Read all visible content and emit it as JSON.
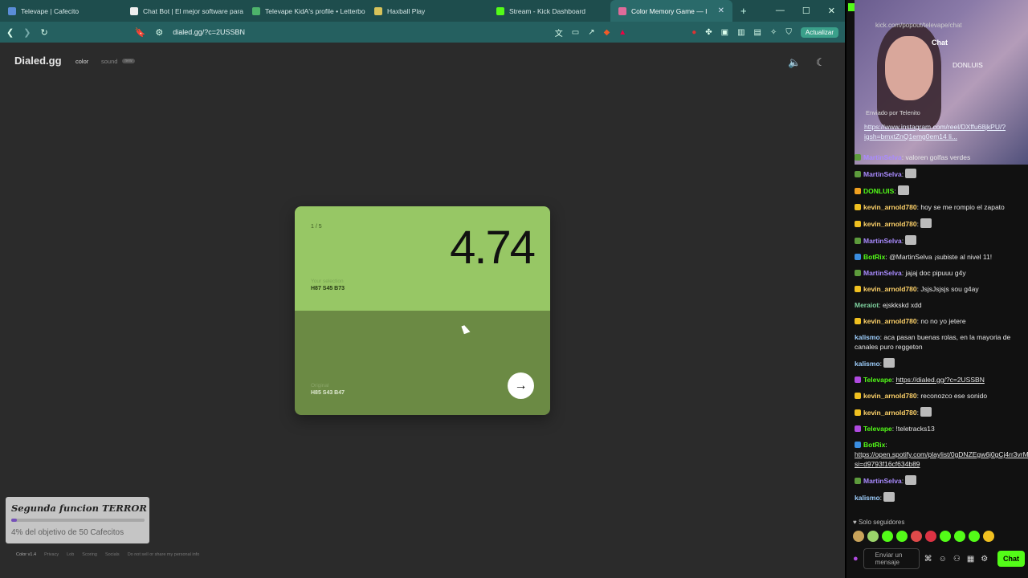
{
  "browser": {
    "tabs": [
      {
        "label": "Televape | Cafecito",
        "color": "#5a8dd8"
      },
      {
        "label": "Chat Bot | El mejor software para",
        "color": "#eeeeee"
      },
      {
        "label": "Televape KidA's profile • Letterbo",
        "color": "#4db36b"
      },
      {
        "label": "Haxball Play",
        "color": "#d8c35a"
      },
      {
        "label": "Stream - Kick Dashboard",
        "color": "#53fc18"
      },
      {
        "label": "Color Memory Game — I",
        "color": "#e06b9a",
        "active": true
      }
    ],
    "new_tab": "+",
    "window_controls": [
      "—",
      "☐",
      "✕"
    ],
    "url": "dialed.gg/?c=2USSBN",
    "update_button": "Actualizar"
  },
  "page": {
    "logo": "Dialed.gg",
    "nav_color": "color",
    "nav_sound": "sound",
    "nav_badge": "new",
    "card": {
      "round": "1 / 5",
      "score": "4.74",
      "selection_label": "Your selection",
      "selection_value": "H87 S45 B73",
      "original_label": "Original",
      "original_value": "H85 S43 B47",
      "selection_color": "#97c765",
      "original_color": "#6b8a44"
    },
    "overlay": {
      "title": "Segunda funcion TERROR",
      "progress_fraction": 0.04,
      "text": "4% del objetivo de 50 Cafecitos"
    },
    "footer": [
      "Color v1.4",
      "Privacy",
      "Lob",
      "Scoring",
      "Socials",
      "Do not sell or share my personal info"
    ]
  },
  "chat": {
    "cam_url": "kick.com/popout/televape/chat",
    "title": "Chat",
    "donluis": "DONLUIS",
    "pinned_by": "Enviado por    Telenito",
    "pinned_link": "https://www.instagram.com/reel/DXffu68jkPU/?igsh=bmxtZnQ1emg0em14 li...",
    "messages": [
      {
        "name": "MartinSelva",
        "color": "#a98bff",
        "badge": "#5d9b3c",
        "text": ": valoren golfas verdes"
      },
      {
        "name": "MartinSelva",
        "color": "#a98bff",
        "badge": "#5d9b3c",
        "text": ":",
        "emote": true
      },
      {
        "name": "DONLUIS",
        "color": "#53fc18",
        "badge": "#f0a020",
        "text": ":",
        "emote": true
      },
      {
        "name": "kevin_arnold780",
        "color": "#ffd36a",
        "badge": "#f0c020",
        "text": ": hoy se me rompio el zapato"
      },
      {
        "name": "kevin_arnold780",
        "color": "#ffd36a",
        "badge": "#f0c020",
        "text": ":",
        "emote": true
      },
      {
        "name": "MartinSelva",
        "color": "#a98bff",
        "badge": "#5d9b3c",
        "text": ":",
        "emote": true
      },
      {
        "name": "BotRix",
        "color": "#53fc18",
        "badge": "#3a8de0",
        "text": ": @MartinSelva ¡subiste al nivel 11!"
      },
      {
        "name": "MartinSelva",
        "color": "#a98bff",
        "badge": "#5d9b3c",
        "text": ": jajaj doc pipuuu g4y"
      },
      {
        "name": "kevin_arnold780",
        "color": "#ffd36a",
        "badge": "#f0c020",
        "text": ": JsjsJsjsjs sou g4ay"
      },
      {
        "name": "Meraiot",
        "color": "#7fd3a0",
        "badge": "",
        "text": ": ejskkskd xdd"
      },
      {
        "name": "kevin_arnold780",
        "color": "#ffd36a",
        "badge": "#f0c020",
        "text": ": no no yo jetere"
      },
      {
        "name": "kalismo",
        "color": "#9fd0ff",
        "badge": "",
        "text": ": aca pasan buenas rolas, en la mayoria de canales puro reggeton"
      },
      {
        "name": "kalismo",
        "color": "#9fd0ff",
        "badge": "",
        "text": ":",
        "emote": true
      },
      {
        "name": "Televape",
        "color": "#53fc18",
        "badge": "#b04ae0",
        "text": ": ",
        "link": "https://dialed.gg/?c=2USSBN"
      },
      {
        "name": "kevin_arnold780",
        "color": "#ffd36a",
        "badge": "#f0c020",
        "text": ": reconozco ese sonido"
      },
      {
        "name": "kevin_arnold780",
        "color": "#ffd36a",
        "badge": "#f0c020",
        "text": ":",
        "emote": true
      },
      {
        "name": "Televape",
        "color": "#53fc18",
        "badge": "#b04ae0",
        "text": ": !teletracks13"
      },
      {
        "name": "BotRix",
        "color": "#53fc18",
        "badge": "#3a8de0",
        "text": ": ",
        "link": "https://open.spotify.com/playlist/0gDNZEgw6j0gCj4rr3vrMZ?si=d9793f16cf634b89"
      },
      {
        "name": "MartinSelva",
        "color": "#a98bff",
        "badge": "#5d9b3c",
        "text": ":",
        "emote": true
      },
      {
        "name": "kalismo",
        "color": "#9fd0ff",
        "badge": "",
        "text": ":",
        "emote": true
      }
    ],
    "followers_only": "♥ Solo seguidores",
    "input_placeholder": "Enviar un mensaje",
    "send_label": "Chat"
  }
}
